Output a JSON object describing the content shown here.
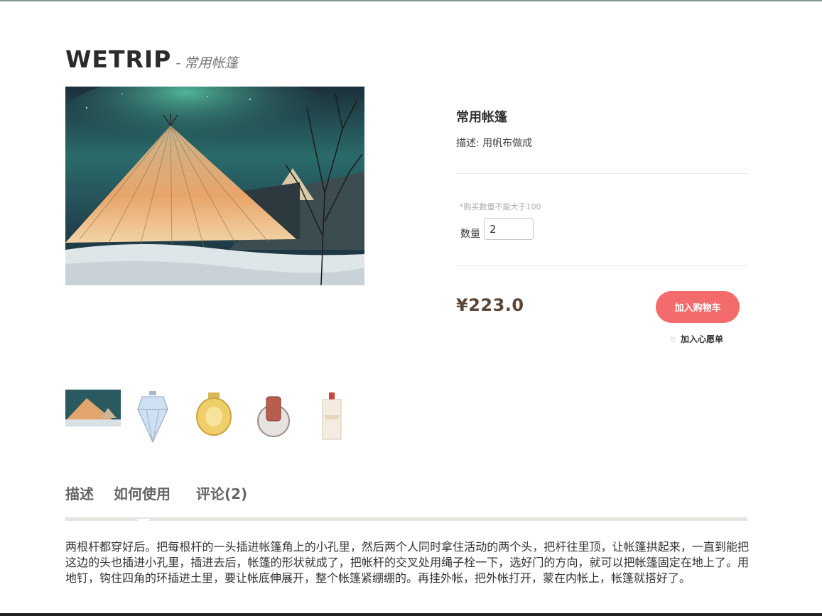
{
  "header": {
    "brand": "WETRIP",
    "dash": "-",
    "subtitle": "常用帐篷"
  },
  "product": {
    "name": "常用帐篷",
    "description_label": "描述:",
    "description_value": "用帆布做成",
    "quantity_note": "*购买数量不能大于100",
    "quantity_label": "数量",
    "quantity_value": "2",
    "price": "¥223.0",
    "add_to_cart_label": "加入购物车",
    "wishlist_label": "加入心愿单"
  },
  "thumbnails": [
    {
      "name": "tent"
    },
    {
      "name": "diamond-perfume"
    },
    {
      "name": "gold-perfume"
    },
    {
      "name": "round-perfume"
    },
    {
      "name": "tall-perfume"
    }
  ],
  "tabs": [
    {
      "label": "描述",
      "active": true
    },
    {
      "label": "如何使用",
      "active": false
    },
    {
      "label": "评论(2)",
      "active": false
    }
  ],
  "content": {
    "text": "两根杆都穿好后。把每根杆的一头插进帐篷角上的小孔里，然后两个人同时拿住活动的两个头，把杆往里顶，让帐篷拱起来，一直到能把这边的头也插进小孔里，插进去后，帐篷的形状就成了，把帐杆的交叉处用绳子栓一下，选好门的方向，就可以把帐篷固定在地上了。用地钉，钩住四角的环插进土里，要让帐底伸展开，整个帐篷紧绷绷的。再挂外帐，把外帐打开，蒙在内帐上，帐篷就搭好了。"
  },
  "colors": {
    "accent_button": "#f36b6b",
    "price": "#5a4636",
    "tab_bar": "#e6e4df"
  }
}
